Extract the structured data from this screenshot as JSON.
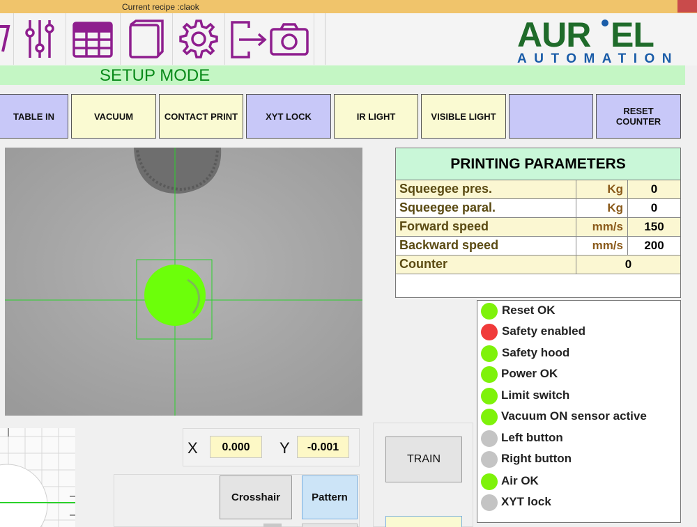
{
  "window": {
    "title": "Current recipe :claok"
  },
  "toolbar": {
    "icons": [
      "partial-icon",
      "sliders-icon",
      "table-icon",
      "window-icon",
      "gear-icon",
      "export-icon",
      "camera-icon"
    ]
  },
  "logo": {
    "name": "AUR'EL",
    "subtitle": "AUTOMATION"
  },
  "mode": {
    "label": "SETUP MODE"
  },
  "top_buttons": [
    {
      "label": "TABLE IN"
    },
    {
      "label": "VACUUM"
    },
    {
      "label": "CONTACT PRINT"
    },
    {
      "label": "XYT LOCK"
    },
    {
      "label": "IR LIGHT"
    },
    {
      "label": "VISIBLE LIGHT"
    },
    {
      "label": ""
    },
    {
      "label": "RESET COUNTER"
    }
  ],
  "params": {
    "title": "PRINTING PARAMETERS",
    "rows": [
      {
        "name": "Squeegee pres.",
        "unit": "Kg",
        "value": "0"
      },
      {
        "name": "Squeegee paral.",
        "unit": "Kg",
        "value": "0"
      },
      {
        "name": "Forward speed",
        "unit": "mm/s",
        "value": "150"
      },
      {
        "name": "Backward speed",
        "unit": "mm/s",
        "value": "200"
      },
      {
        "name": "Counter",
        "unit": "",
        "value": "0"
      }
    ]
  },
  "status": [
    {
      "label": "Reset OK",
      "state": "green"
    },
    {
      "label": "Safety enabled",
      "state": "red"
    },
    {
      "label": "Safety hood",
      "state": "green"
    },
    {
      "label": "Power OK",
      "state": "green"
    },
    {
      "label": "Limit switch",
      "state": "green"
    },
    {
      "label": "Vacuum ON sensor active",
      "state": "green"
    },
    {
      "label": "Left button",
      "state": "gray"
    },
    {
      "label": "Right button",
      "state": "gray"
    },
    {
      "label": "Air OK",
      "state": "green"
    },
    {
      "label": "XYT lock",
      "state": "gray"
    }
  ],
  "coords": {
    "x_label": "X",
    "x_value": "0.000",
    "y_label": "Y",
    "y_value": "-0.001"
  },
  "buttons": {
    "crosshair": "Crosshair",
    "pattern": "Pattern",
    "train": "TRAIN"
  },
  "colors": {
    "accent_purple": "#8e1e8e",
    "logo_green": "#1f6b2a",
    "logo_blue": "#1a5ca8",
    "status_green": "#7ef20a",
    "status_red": "#f03a3a",
    "status_gray": "#c4c4c4"
  }
}
